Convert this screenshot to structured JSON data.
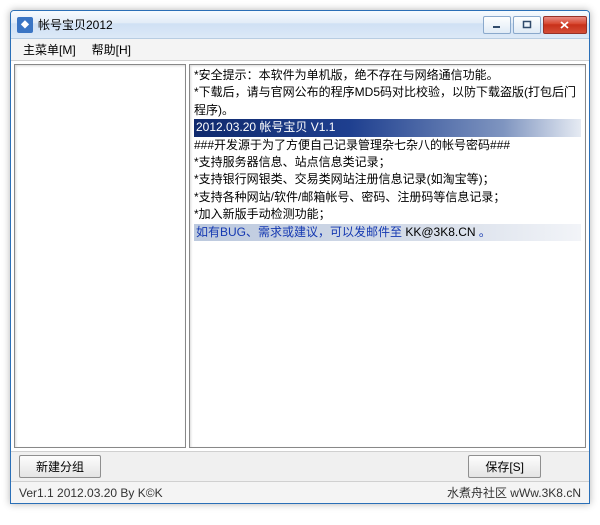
{
  "window": {
    "title": "帐号宝贝2012"
  },
  "menu": {
    "main": "主菜单[M]",
    "help": "帮助[H]"
  },
  "content": {
    "lines": [
      "*安全提示：本软件为单机版，绝不存在与网络通信功能。",
      "*下载后，请与官网公布的程序MD5码对比校验，以防下载盗版(打包后门程序)。"
    ],
    "banner1": "2012.03.20    帐号宝贝 V1.1",
    "lines2": [
      "###开发源于为了方便自己记录管理杂七杂八的帐号密码###",
      "*支持服务器信息、站点信息类记录；",
      "*支持银行网银类、交易类网站注册信息记录(如淘宝等)；",
      "*支持各种网站/软件/邮箱帐号、密码、注册码等信息记录；",
      "*加入新版手动检测功能；"
    ],
    "banner2_prefix": "如有BUG、需求或建议，可以发邮件至 ",
    "banner2_email": "KK@3K8.CN",
    "banner2_suffix": " 。"
  },
  "buttons": {
    "new_group": "新建分组",
    "save": "保存[S]"
  },
  "status": {
    "left": "Ver1.1 2012.03.20 By K©K",
    "right": "水煮舟社区 wWw.3K8.cN"
  }
}
